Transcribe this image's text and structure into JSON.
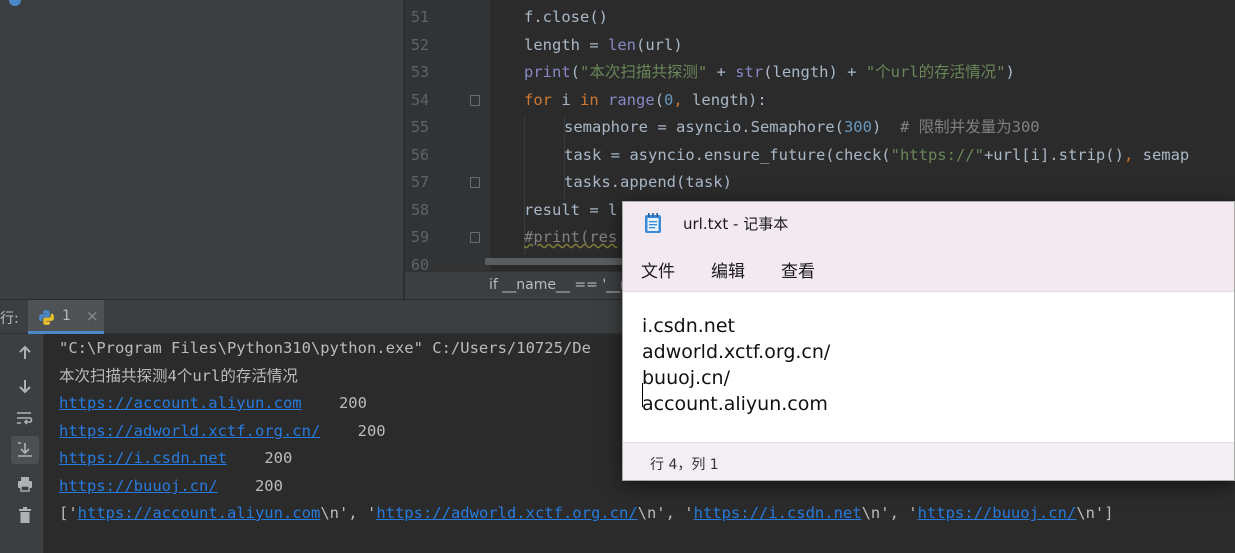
{
  "editor": {
    "lines": [
      {
        "num": "51"
      },
      {
        "num": "52"
      },
      {
        "num": "53"
      },
      {
        "num": "54"
      },
      {
        "num": "55"
      },
      {
        "num": "56"
      },
      {
        "num": "57"
      },
      {
        "num": "58"
      },
      {
        "num": "59"
      },
      {
        "num": "60"
      }
    ],
    "code": {
      "l51": "f.close()",
      "l52_a": "length = ",
      "l52_b": "len",
      "l52_c": "(url)",
      "l53_a": "print",
      "l53_b": "(",
      "l53_c": "\"本次扫描共探测\"",
      "l53_d": " + ",
      "l53_e": "str",
      "l53_f": "(length) + ",
      "l53_g": "\"个url的存活情况\"",
      "l53_h": ")",
      "l54_a": "for",
      "l54_b": " i ",
      "l54_c": "in",
      "l54_d": " ",
      "l54_e": "range",
      "l54_f": "(",
      "l54_g": "0",
      "l54_h": ", ",
      "l54_i": "length):",
      "l55_a": "semaphore = asyncio.Semaphore(",
      "l55_b": "300",
      "l55_c": ")  ",
      "l55_d": "# 限制并发量为300",
      "l56_a": "task = asyncio.ensure_future(check(",
      "l56_b": "\"https://\"",
      "l56_c": "+url[i].strip()",
      "l56_d": ", ",
      "l56_e": "semap",
      "l57": "tasks.append(task)",
      "l58": "result = l",
      "l59": "#print(res"
    },
    "breadcrumb": "if __name__ == '__m"
  },
  "run_panel": {
    "label": "行:",
    "tab_label": "1",
    "tab_close": "×",
    "console": {
      "cmd": "\"C:\\Program Files\\Python310\\python.exe\" C:/Users/10725/De",
      "summary": "本次扫描共探测4个url的存活情况",
      "results": [
        {
          "url": "https://account.aliyun.com",
          "status": "200"
        },
        {
          "url": "https://adworld.xctf.org.cn/",
          "status": "200"
        },
        {
          "url": "https://i.csdn.net",
          "status": "200"
        },
        {
          "url": "https://buuoj.cn/",
          "status": "200"
        }
      ],
      "list_line": {
        "open": "['",
        "u1": "https://account.aliyun.com",
        "sep1": "\\n', '",
        "u2": "https://adworld.xctf.org.cn/",
        "sep2": "\\n', '",
        "u3": "https://i.csdn.net",
        "sep3": "\\n', '",
        "u4": "https://buuoj.cn/",
        "close": "\\n']"
      }
    },
    "toolbar_icons": [
      "arrow-up-icon",
      "arrow-down-icon",
      "soft-wrap-icon",
      "scroll-to-end-icon",
      "print-icon",
      "trash-icon"
    ]
  },
  "notepad": {
    "title": "url.txt - 记事本",
    "menu": [
      "文件",
      "编辑",
      "查看"
    ],
    "lines": [
      "i.csdn.net",
      "adworld.xctf.org.cn/",
      "buuoj.cn/",
      "account.aliyun.com"
    ],
    "status": "行 4，列 1"
  },
  "colors": {
    "editor_bg": "#2b2b2b",
    "keyword": "#cc7832",
    "string": "#6a8759",
    "number": "#6897bb",
    "builtin": "#8888c6",
    "link": "#287bde"
  }
}
